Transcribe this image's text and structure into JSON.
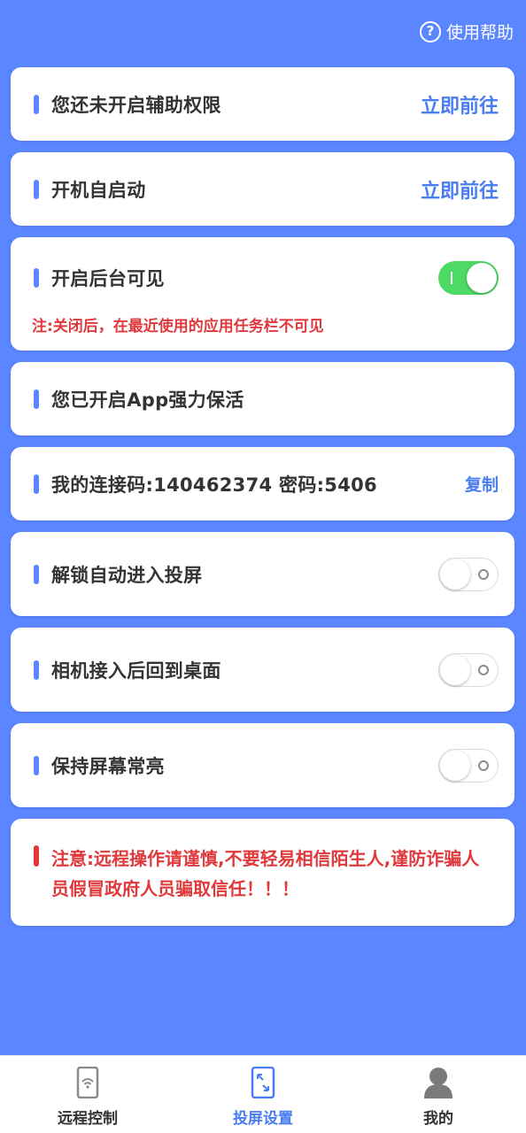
{
  "header": {
    "help_label": "使用帮助",
    "help_icon": "question-circle-icon"
  },
  "cards": {
    "accessibility": {
      "label": "您还未开启辅助权限",
      "action": "立即前往"
    },
    "autostart": {
      "label": "开机自启动",
      "action": "立即前往"
    },
    "background_visible": {
      "label": "开启后台可见",
      "toggle": true,
      "note": "注:关闭后，在最近使用的应用任务栏不可见"
    },
    "keep_alive": {
      "label": "您已开启App强力保活"
    },
    "connection": {
      "label": "我的连接码:140462374 密码:5406",
      "action": "复制"
    },
    "unlock_cast": {
      "label": "解锁自动进入投屏",
      "toggle": false
    },
    "camera_home": {
      "label": "相机接入后回到桌面",
      "toggle": false
    },
    "keep_screen_on": {
      "label": "保持屏幕常亮",
      "toggle": false
    },
    "warning": {
      "text": "注意:远程操作请谨慎,不要轻易相信陌生人,谨防诈骗人员假冒政府人员骗取信任！！！"
    }
  },
  "bottom_nav": {
    "items": [
      {
        "label": "远程控制",
        "icon": "phone-wifi-icon",
        "active": false
      },
      {
        "label": "投屏设置",
        "icon": "screen-cast-icon",
        "active": true
      },
      {
        "label": "我的",
        "icon": "user-icon",
        "active": false
      }
    ]
  },
  "colors": {
    "background": "#5b86ff",
    "accent": "#4a7ef0",
    "warning": "#e0393c",
    "toggle_on": "#4cd964"
  }
}
